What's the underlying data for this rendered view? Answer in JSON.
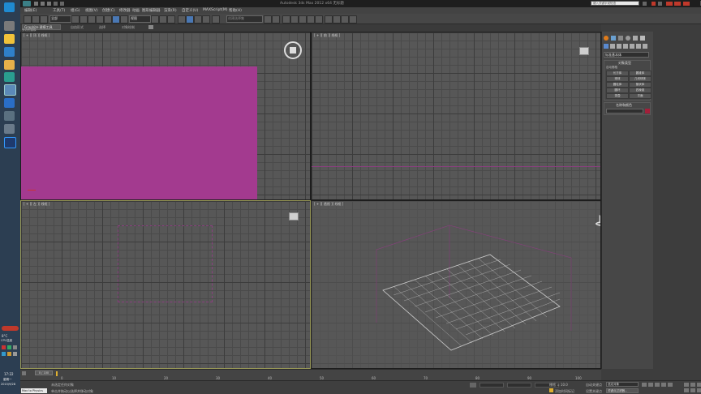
{
  "app": {
    "title": "Autodesk 3ds Max  2012 x64    无标题",
    "search_placeholder": "键入关键字或短语"
  },
  "menu": [
    "编辑(E)",
    "工具(T)",
    "组(G)",
    "视图(V)",
    "创建(C)",
    "修改器",
    "动画",
    "图形编辑器",
    "渲染(R)",
    "自定义(U)",
    "MAXScript(M)",
    "帮助(H)"
  ],
  "toolbar": {
    "filter_label": "全部",
    "refcoord_label": "视图",
    "named_selection_placeholder": "创建选择集"
  },
  "ribbon": {
    "tabs": [
      "Graphite 建模工具",
      "自由形式",
      "选择",
      "对象绘制"
    ],
    "sub_label": "多边形建模"
  },
  "viewports": [
    {
      "label": "[ + ][ 顶 ][ 线框 ]",
      "name": "top"
    },
    {
      "label": "[ + ][ 前 ][ 线框 ]",
      "name": "front"
    },
    {
      "label": "[ + ][ 左 ][ 线框 ]",
      "name": "left"
    },
    {
      "label": "[ + ][ 透视 ][ 线框 ]",
      "name": "perspective"
    }
  ],
  "colors": {
    "plane_fill": "#a33a8f",
    "viewport_bg": "#575757",
    "taskbar": "#2c3e52",
    "active_border": "#9a9a58"
  },
  "command_panel": {
    "dropdown": "标准基本体",
    "rollout_type": "对象类型",
    "autogrid": "自动栅格",
    "objects": [
      "长方体",
      "圆锥体",
      "球体",
      "几何球体",
      "圆柱体",
      "管状体",
      "圆环",
      "四棱锥",
      "茶壶",
      "平面"
    ],
    "rollout_name": "名称和颜色"
  },
  "timeline": {
    "slider_label": "0 / 100",
    "ticks": [
      "0",
      "10",
      "20",
      "30",
      "40",
      "50",
      "60",
      "70",
      "80",
      "90",
      "100"
    ]
  },
  "status": {
    "script_label": "Max to Physics",
    "line1": "未选定任何对象",
    "line2": "单击并拖动以选择并移动对象",
    "grid_label": "栅格 = 10.0",
    "autokey_label": "自动关键点",
    "setkey_label": "设置关键点",
    "selected_label": "选定对象",
    "filter_label": "关键点过滤器...",
    "add_time_tag": "添加时间标记"
  },
  "taskbar": {
    "temperature": "8°C",
    "weather": "CPU温度",
    "time": "17:22",
    "day": "星期一",
    "date": "2015/9/28"
  }
}
